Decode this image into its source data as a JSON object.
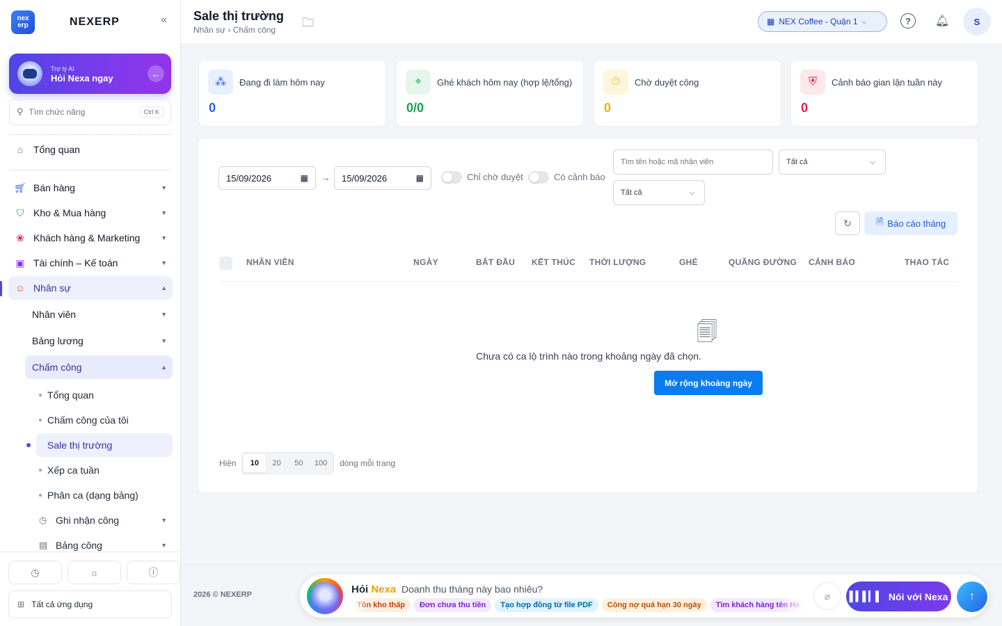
{
  "sidebar": {
    "logo_top": "nex",
    "logo_bottom": "erp",
    "brand": "NEXERP",
    "collapse_icon": "«",
    "ai": {
      "sub": "Trợ lý AI",
      "title": "Hỏi Nexa ngay"
    },
    "search": {
      "placeholder": "Tìm chức năng",
      "shortcut": "Ctrl K"
    },
    "overview": "Tổng quan",
    "groups": [
      {
        "label": "Bán hàng",
        "icon": "cart-icon"
      },
      {
        "label": "Kho & Mua hàng",
        "icon": "bag-icon"
      },
      {
        "label": "Khách hàng & Marketing",
        "icon": "users-icon"
      },
      {
        "label": "Tài chính – Kế toán",
        "icon": "calculator-icon"
      },
      {
        "label": "Nhân sự",
        "icon": "person-icon"
      }
    ],
    "hr_sub": [
      "Nhân viên",
      "Bảng lương",
      "Chấm công"
    ],
    "attendance_items": [
      "Tổng quan",
      "Chấm công của tôi",
      "Sale thị trường",
      "Xếp ca tuần",
      "Phân ca (dạng bảng)"
    ],
    "attendance_more": [
      "Ghi nhận công",
      "Bảng công"
    ],
    "all_apps": "Tất cả ứng dụng"
  },
  "header": {
    "title": "Sale thị trường",
    "breadcrumb": "Nhân sự › Chấm công",
    "branch": "NEX Coffee - Quận 1",
    "avatar": "S"
  },
  "stats": [
    {
      "label": "Đang đi làm hôm nay",
      "value": "0",
      "color": "#2563eb",
      "bg": "#e8effd"
    },
    {
      "label": "Ghé khách hôm nay (hợp lệ/tổng)",
      "value": "0/0",
      "color": "#16a34a",
      "bg": "#e6f6ec"
    },
    {
      "label": "Chờ duyệt công",
      "value": "0",
      "color": "#eab308",
      "bg": "#fdf6dc"
    },
    {
      "label": "Cảnh báo gian lận tuần này",
      "value": "0",
      "color": "#e11d48",
      "bg": "#fde8ec"
    }
  ],
  "filters": {
    "date_from": "15/09/2026",
    "date_to": "15/09/2026",
    "toggle_pending": "Chỉ chờ duyệt",
    "toggle_warning": "Có cảnh báo",
    "search_placeholder": "Tìm tên hoặc mã nhân viên",
    "select1": "Tất cả",
    "select2": "Tất cả",
    "report_label": "Báo cáo tháng"
  },
  "table": {
    "columns": [
      "NHÂN VIÊN",
      "NGÀY",
      "BẮT ĐẦU",
      "KẾT THÚC",
      "THỜI LƯỢNG",
      "GHÉ",
      "QUÃNG ĐƯỜNG",
      "CẢNH BÁO",
      "THAO TÁC"
    ],
    "empty_text": "Chưa có ca lộ trình nào trong khoảng ngày đã chọn.",
    "expand_label": "Mở rộng khoảng ngày"
  },
  "pagination": {
    "prefix": "Hiện",
    "suffix": "dòng mỗi trang",
    "options": [
      "10",
      "20",
      "50",
      "100"
    ],
    "selected": "10"
  },
  "footer": {
    "copyright": "2026 © NEXERP",
    "nexa_prefix": "Hỏi",
    "nexa_name": "Nexa",
    "question": "Doanh thu tháng này bao nhiêu?",
    "chips": [
      {
        "label": "Tồn kho thấp",
        "bg": "#fdeee0",
        "color": "#c2410c"
      },
      {
        "label": "Đơn chưa thu tiền",
        "bg": "#f3e8fd",
        "color": "#7e22ce"
      },
      {
        "label": "Tạo hợp đồng từ file PDF",
        "bg": "#e0f2fe",
        "color": "#0369a1"
      },
      {
        "label": "Công nợ quá hạn 30 ngày",
        "bg": "#fdf0dc",
        "color": "#b45309"
      },
      {
        "label": "Tìm khách hàng tên Hà",
        "bg": "#f3e8fd",
        "color": "#7e22ce"
      }
    ],
    "talk_label": "Nói với Nexa"
  }
}
